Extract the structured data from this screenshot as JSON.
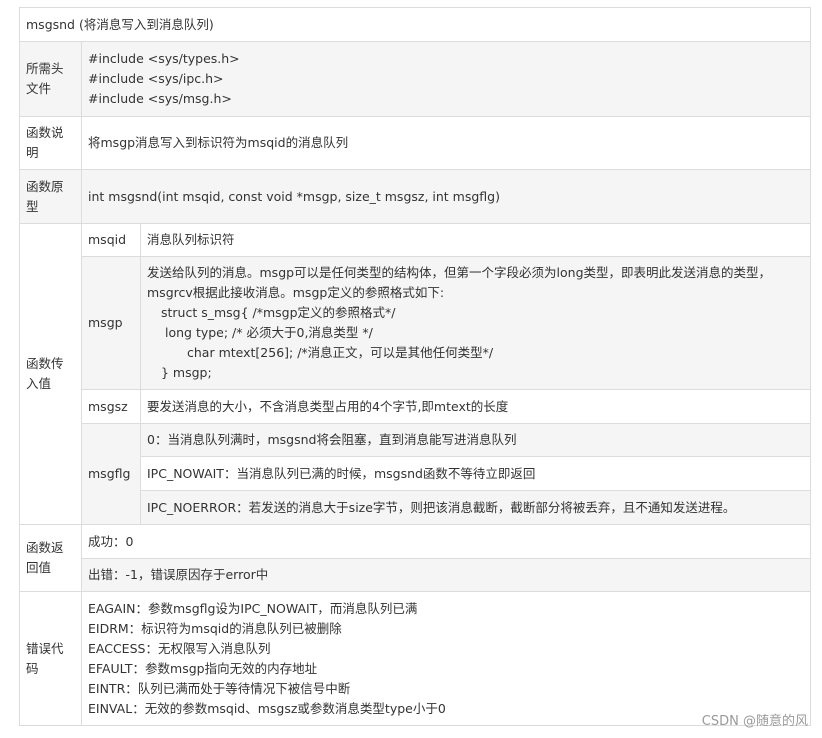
{
  "title": "msgsnd (将消息写入到消息队列)",
  "headers_row": {
    "label": [
      "所需头",
      "文件"
    ],
    "lines": [
      "#include <sys/types.h>",
      "#include <sys/ipc.h>",
      "#include <sys/msg.h>"
    ]
  },
  "description_row": {
    "label": [
      "函数说",
      "明"
    ],
    "text": "将msgp消息写入到标识符为msqid的消息队列"
  },
  "prototype_row": {
    "label": [
      "函数原",
      "型"
    ],
    "text": "int msgsnd(int msqid, const void *msgp, size_t msgsz, int msgflg)"
  },
  "params": {
    "label": [
      "函数传",
      "入值"
    ],
    "msqid": {
      "name": "msqid",
      "text": "消息队列标识符"
    },
    "msgp": {
      "name": "msgp",
      "lines": [
        "发送给队列的消息。msgp可以是任何类型的结构体，但第一个字段必须为long类型，即表明此发送消息的类型，",
        "msgrcv根据此接收消息。msgp定义的参照格式如下:",
        "struct s_msg{ /*msgp定义的参照格式*/",
        "long type; /* 必须大于0,消息类型 */",
        "char mtext[256]; /*消息正文，可以是其他任何类型*/",
        "} msgp;"
      ]
    },
    "msgsz": {
      "name": "msgsz",
      "text": "要发送消息的大小，不含消息类型占用的4个字节,即mtext的长度"
    },
    "msgflg": {
      "name": "msgflg",
      "options": [
        "0：当消息队列满时，msgsnd将会阻塞，直到消息能写进消息队列",
        "IPC_NOWAIT：当消息队列已满的时候，msgsnd函数不等待立即返回",
        "IPC_NOERROR：若发送的消息大于size字节，则把该消息截断，截断部分将被丢弃，且不通知发送进程。"
      ]
    }
  },
  "return_row": {
    "label": [
      "函数返",
      "回值"
    ],
    "success": "成功：0",
    "error": "出错：-1，错误原因存于error中"
  },
  "errors_row": {
    "label": [
      "错误代",
      "码"
    ],
    "lines": [
      "EAGAIN：参数msgflg设为IPC_NOWAIT，而消息队列已满",
      "EIDRM：标识符为msqid的消息队列已被删除",
      "EACCESS：无权限写入消息队列",
      "EFAULT：参数msgp指向无效的内存地址",
      "EINTR：队列已满而处于等待情况下被信号中断",
      "EINVAL：无效的参数msqid、msgsz或参数消息类型type小于0"
    ]
  },
  "watermark": "CSDN @随意的风"
}
